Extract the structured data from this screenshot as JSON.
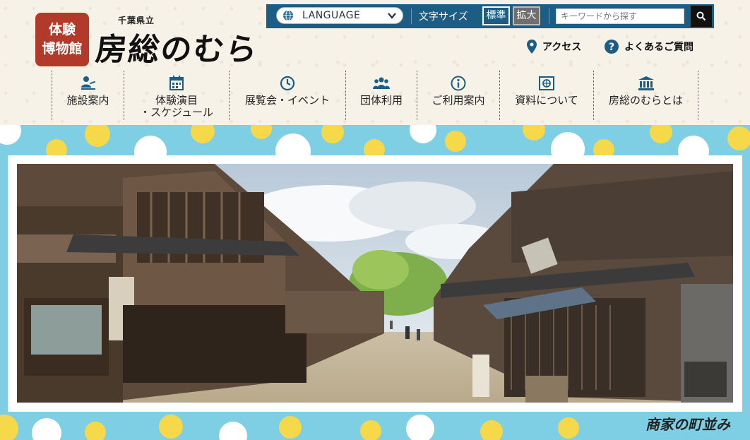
{
  "logo": {
    "badge_line1": "体験",
    "badge_line2": "博物館",
    "subtitle": "千葉県立",
    "title": "房総のむら"
  },
  "topbar": {
    "language_label": "LANGUAGE",
    "fontsize_label": "文字サイズ",
    "fontsize_standard": "標準",
    "fontsize_large": "拡大",
    "search_placeholder": "キーワードから探す"
  },
  "util": {
    "access": "アクセス",
    "faq": "よくあるご質問"
  },
  "nav": [
    {
      "label": "施設案内",
      "icon": "person-desk-icon"
    },
    {
      "label": "体験演目\n・スケジュール",
      "icon": "calendar-icon"
    },
    {
      "label": "展覧会・イベント",
      "icon": "clock-icon"
    },
    {
      "label": "団体利用",
      "icon": "group-icon"
    },
    {
      "label": "ご利用案内",
      "icon": "info-icon"
    },
    {
      "label": "資料について",
      "icon": "document-icon"
    },
    {
      "label": "房総のむらとは",
      "icon": "museum-icon"
    }
  ],
  "hero": {
    "caption": "商家の町並み"
  },
  "colors": {
    "topbar": "#1c5d86",
    "badge": "#b23a2a",
    "hero_bg": "#7fcfe4",
    "dot_yellow": "#f5d94a"
  }
}
